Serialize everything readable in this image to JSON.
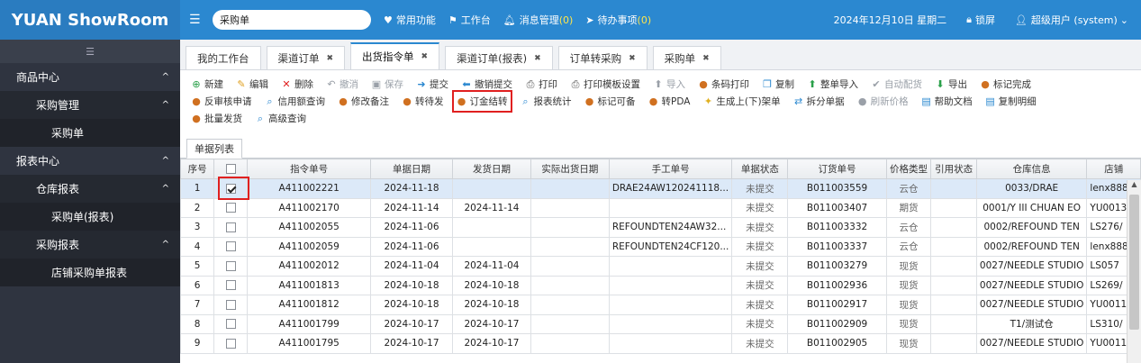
{
  "brand": "YUAN ShowRoom",
  "topbar": {
    "search_value": "采购单",
    "items": [
      {
        "icon": "heart-icon",
        "label": "常用功能",
        "count": ""
      },
      {
        "icon": "flag-icon",
        "label": "工作台",
        "count": ""
      },
      {
        "icon": "bell-icon",
        "label": "消息管理",
        "count": "(0)"
      },
      {
        "icon": "send-icon",
        "label": "待办事项",
        "count": "(0)"
      }
    ],
    "date": "2024年12月10日 星期二",
    "lock": "锁屏",
    "user": "超级用户 (system)"
  },
  "sidebar": {
    "items": [
      {
        "label": "商品中心",
        "level": 1,
        "caret": "^"
      },
      {
        "label": "采购管理",
        "level": 2,
        "caret": "^"
      },
      {
        "label": "采购单",
        "level": 3,
        "caret": ""
      },
      {
        "label": "报表中心",
        "level": 1,
        "caret": "^"
      },
      {
        "label": "仓库报表",
        "level": 2,
        "caret": "^"
      },
      {
        "label": "采购单(报表)",
        "level": 3,
        "caret": ""
      },
      {
        "label": "采购报表",
        "level": 2,
        "caret": "^"
      },
      {
        "label": "店铺采购单报表",
        "level": 3,
        "caret": ""
      }
    ]
  },
  "tabs": [
    {
      "label": "我的工作台",
      "closable": false,
      "active": false
    },
    {
      "label": "渠道订单",
      "closable": true,
      "active": false
    },
    {
      "label": "出货指令单",
      "closable": true,
      "active": true
    },
    {
      "label": "渠道订单(报表)",
      "closable": true,
      "active": false
    },
    {
      "label": "订单转采购",
      "closable": true,
      "active": false
    },
    {
      "label": "采购单",
      "closable": true,
      "active": false
    }
  ],
  "toolbar": {
    "rows": [
      [
        {
          "icon": "plus-circle-icon",
          "label": "新建",
          "color": "#2aa04a",
          "disabled": false
        },
        {
          "icon": "edit-icon",
          "label": "编辑",
          "color": "#e0a020",
          "disabled": false
        },
        {
          "icon": "delete-x-icon",
          "label": "删除",
          "color": "#e02020",
          "disabled": false
        },
        {
          "icon": "undo-icon",
          "label": "撤消",
          "color": "#9aa0a8",
          "disabled": true
        },
        {
          "icon": "save-icon",
          "label": "保存",
          "color": "#9aa0a8",
          "disabled": true
        },
        {
          "icon": "submit-arrow-icon",
          "label": "提交",
          "color": "#2b88d0",
          "disabled": false
        },
        {
          "icon": "revoke-arrow-icon",
          "label": "撤销提交",
          "color": "#2b88d0",
          "disabled": false
        },
        {
          "icon": "printer-icon",
          "label": "打印",
          "color": "#555555",
          "disabled": false
        },
        {
          "icon": "printer-icon",
          "label": "打印模板设置",
          "color": "#555555",
          "disabled": false
        },
        {
          "icon": "import-icon",
          "label": "导入",
          "color": "#9aa0a8",
          "disabled": true
        },
        {
          "icon": "user-icon",
          "label": "条码打印",
          "color": "#d07020",
          "disabled": false
        },
        {
          "icon": "copy-icon",
          "label": "复制",
          "color": "#2b88d0",
          "disabled": false
        },
        {
          "icon": "import-icon",
          "label": "整单导入",
          "color": "#2aa04a",
          "disabled": false
        },
        {
          "icon": "check-icon",
          "label": "自动配货",
          "color": "#9aa0a8",
          "disabled": true
        },
        {
          "icon": "export-icon",
          "label": "导出",
          "color": "#2aa04a",
          "disabled": false
        },
        {
          "icon": "user-icon",
          "label": "标记完成",
          "color": "#d07020",
          "disabled": false
        }
      ],
      [
        {
          "icon": "user-icon",
          "label": "反审核申请",
          "color": "#d07020",
          "disabled": false
        },
        {
          "icon": "search-icon",
          "label": "信用额查询",
          "color": "#2b88d0",
          "disabled": false
        },
        {
          "icon": "user-icon",
          "label": "修改备注",
          "color": "#d07020",
          "disabled": false
        },
        {
          "icon": "user-icon",
          "label": "转待发",
          "color": "#d07020",
          "disabled": false
        },
        {
          "icon": "user-icon",
          "label": "订金结转",
          "color": "#d07020",
          "disabled": false,
          "highlight": true
        },
        {
          "icon": "search-icon",
          "label": "报表统计",
          "color": "#2b88d0",
          "disabled": false
        },
        {
          "icon": "user-icon",
          "label": "标记可备",
          "color": "#d07020",
          "disabled": false
        },
        {
          "icon": "user-icon",
          "label": "转PDA",
          "color": "#d07020",
          "disabled": false
        },
        {
          "icon": "bulb-icon",
          "label": "生成上(下)架单",
          "color": "#e0b020",
          "disabled": false
        },
        {
          "icon": "split-icon",
          "label": "拆分单据",
          "color": "#2b88d0",
          "disabled": false
        },
        {
          "icon": "user-icon",
          "label": "刷新价格",
          "color": "#9aa0a8",
          "disabled": true
        },
        {
          "icon": "doc-icon",
          "label": "帮助文档",
          "color": "#2b88d0",
          "disabled": false
        },
        {
          "icon": "doc-icon",
          "label": "复制明细",
          "color": "#2b88d0",
          "disabled": false
        }
      ],
      [
        {
          "icon": "user-icon",
          "label": "批量发货",
          "color": "#d07020",
          "disabled": false
        },
        {
          "icon": "search-icon",
          "label": "高级查询",
          "color": "#2b88d0",
          "disabled": false
        }
      ]
    ]
  },
  "list_tab": "单据列表",
  "table": {
    "columns": [
      "序号",
      "",
      "指令单号",
      "单据日期",
      "发货日期",
      "实际出货日期",
      "手工单号",
      "单据状态",
      "订货单号",
      "价格类型",
      "引用状态",
      "仓库信息",
      "店铺"
    ],
    "rows": [
      {
        "seq": "1",
        "checked": true,
        "no": "A411002221",
        "date": "2024-11-18",
        "ship": "",
        "actual": "",
        "manual": "DRAE24AW120241118...",
        "state": "未提交",
        "order": "B011003559",
        "ptype": "云仓",
        "ref": "",
        "wh": "0033/DRAE",
        "shop": "lenx888"
      },
      {
        "seq": "2",
        "checked": false,
        "no": "A411002170",
        "date": "2024-11-14",
        "ship": "2024-11-14",
        "actual": "",
        "manual": "",
        "state": "未提交",
        "order": "B011003407",
        "ptype": "期货",
        "ref": "",
        "wh": "0001/Y III CHUAN EO",
        "shop": "YU0013"
      },
      {
        "seq": "3",
        "checked": false,
        "no": "A411002055",
        "date": "2024-11-06",
        "ship": "",
        "actual": "",
        "manual": "REFOUNDTEN24AW32...",
        "state": "未提交",
        "order": "B011003332",
        "ptype": "云仓",
        "ref": "",
        "wh": "0002/REFOUND TEN",
        "shop": "LS276/"
      },
      {
        "seq": "4",
        "checked": false,
        "no": "A411002059",
        "date": "2024-11-06",
        "ship": "",
        "actual": "",
        "manual": "REFOUNDTEN24CF120...",
        "state": "未提交",
        "order": "B011003337",
        "ptype": "云仓",
        "ref": "",
        "wh": "0002/REFOUND TEN",
        "shop": "lenx888"
      },
      {
        "seq": "5",
        "checked": false,
        "no": "A411002012",
        "date": "2024-11-04",
        "ship": "2024-11-04",
        "actual": "",
        "manual": "",
        "state": "未提交",
        "order": "B011003279",
        "ptype": "现货",
        "ref": "",
        "wh": "0027/NEEDLE STUDIO",
        "shop": "LS057"
      },
      {
        "seq": "6",
        "checked": false,
        "no": "A411001813",
        "date": "2024-10-18",
        "ship": "2024-10-18",
        "actual": "",
        "manual": "",
        "state": "未提交",
        "order": "B011002936",
        "ptype": "现货",
        "ref": "",
        "wh": "0027/NEEDLE STUDIO",
        "shop": "LS269/"
      },
      {
        "seq": "7",
        "checked": false,
        "no": "A411001812",
        "date": "2024-10-18",
        "ship": "2024-10-18",
        "actual": "",
        "manual": "",
        "state": "未提交",
        "order": "B011002917",
        "ptype": "现货",
        "ref": "",
        "wh": "0027/NEEDLE STUDIO",
        "shop": "YU0011"
      },
      {
        "seq": "8",
        "checked": false,
        "no": "A411001799",
        "date": "2024-10-17",
        "ship": "2024-10-17",
        "actual": "",
        "manual": "",
        "state": "未提交",
        "order": "B011002909",
        "ptype": "现货",
        "ref": "",
        "wh": "T1/测试仓",
        "shop": "LS310/"
      },
      {
        "seq": "9",
        "checked": false,
        "no": "A411001795",
        "date": "2024-10-17",
        "ship": "2024-10-17",
        "actual": "",
        "manual": "",
        "state": "未提交",
        "order": "B011002905",
        "ptype": "现货",
        "ref": "",
        "wh": "0027/NEEDLE STUDIO",
        "shop": "YU0011"
      }
    ]
  }
}
